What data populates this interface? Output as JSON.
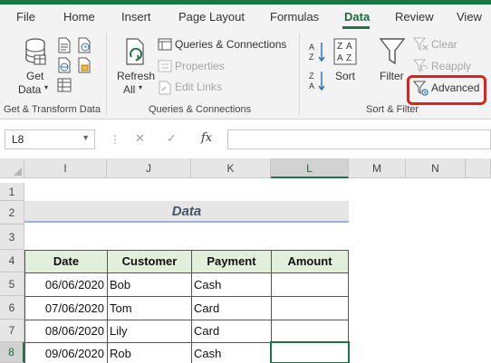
{
  "ribbon_tabs": [
    "File",
    "Home",
    "Insert",
    "Page Layout",
    "Formulas",
    "Data",
    "Review",
    "View"
  ],
  "active_tab": "Data",
  "get_transform": {
    "get_data_line1": "Get",
    "get_data_line2": "Data",
    "group_label": "Get & Transform Data"
  },
  "queries": {
    "refresh_line1": "Refresh",
    "refresh_line2": "All",
    "queries_connections": "Queries & Connections",
    "properties": "Properties",
    "edit_links": "Edit Links",
    "group_label": "Queries & Connections"
  },
  "sort_filter": {
    "sort": "Sort",
    "filter": "Filter",
    "clear": "Clear",
    "reapply": "Reapply",
    "advanced": "Advanced",
    "group_label": "Sort & Filter"
  },
  "formula_bar": {
    "name_box": "L8",
    "fx": "fx",
    "formula": ""
  },
  "columns": [
    "I",
    "J",
    "K",
    "L",
    "M",
    "N"
  ],
  "selected_column": "L",
  "rows": [
    "1",
    "2",
    "3",
    "4",
    "5",
    "6",
    "7",
    "8"
  ],
  "selected_row": "8",
  "sheet": {
    "title": "Data",
    "headers": [
      "Date",
      "Customer",
      "Payment",
      "Amount"
    ],
    "records": [
      [
        "06/06/2020",
        "Bob",
        "Cash",
        ""
      ],
      [
        "07/06/2020",
        "Tom",
        "Card",
        ""
      ],
      [
        "08/06/2020",
        "Lily",
        "Card",
        ""
      ],
      [
        "09/06/2020",
        "Rob",
        "Cash",
        ""
      ]
    ]
  },
  "colors": {
    "accent": "#217346",
    "header_fill": "#e2efda",
    "highlight": "#e02020"
  },
  "icons": [
    "database-icon",
    "text-csv-icon",
    "web-icon",
    "table-range-icon",
    "recent-sources-icon",
    "existing-connections-icon",
    "refresh-icon",
    "queries-connections-icon",
    "properties-icon",
    "edit-links-icon",
    "sort-az-icon",
    "sort-za-icon",
    "sort-dialog-icon",
    "filter-funnel-icon",
    "clear-filter-icon",
    "reapply-filter-icon",
    "advanced-filter-icon"
  ]
}
